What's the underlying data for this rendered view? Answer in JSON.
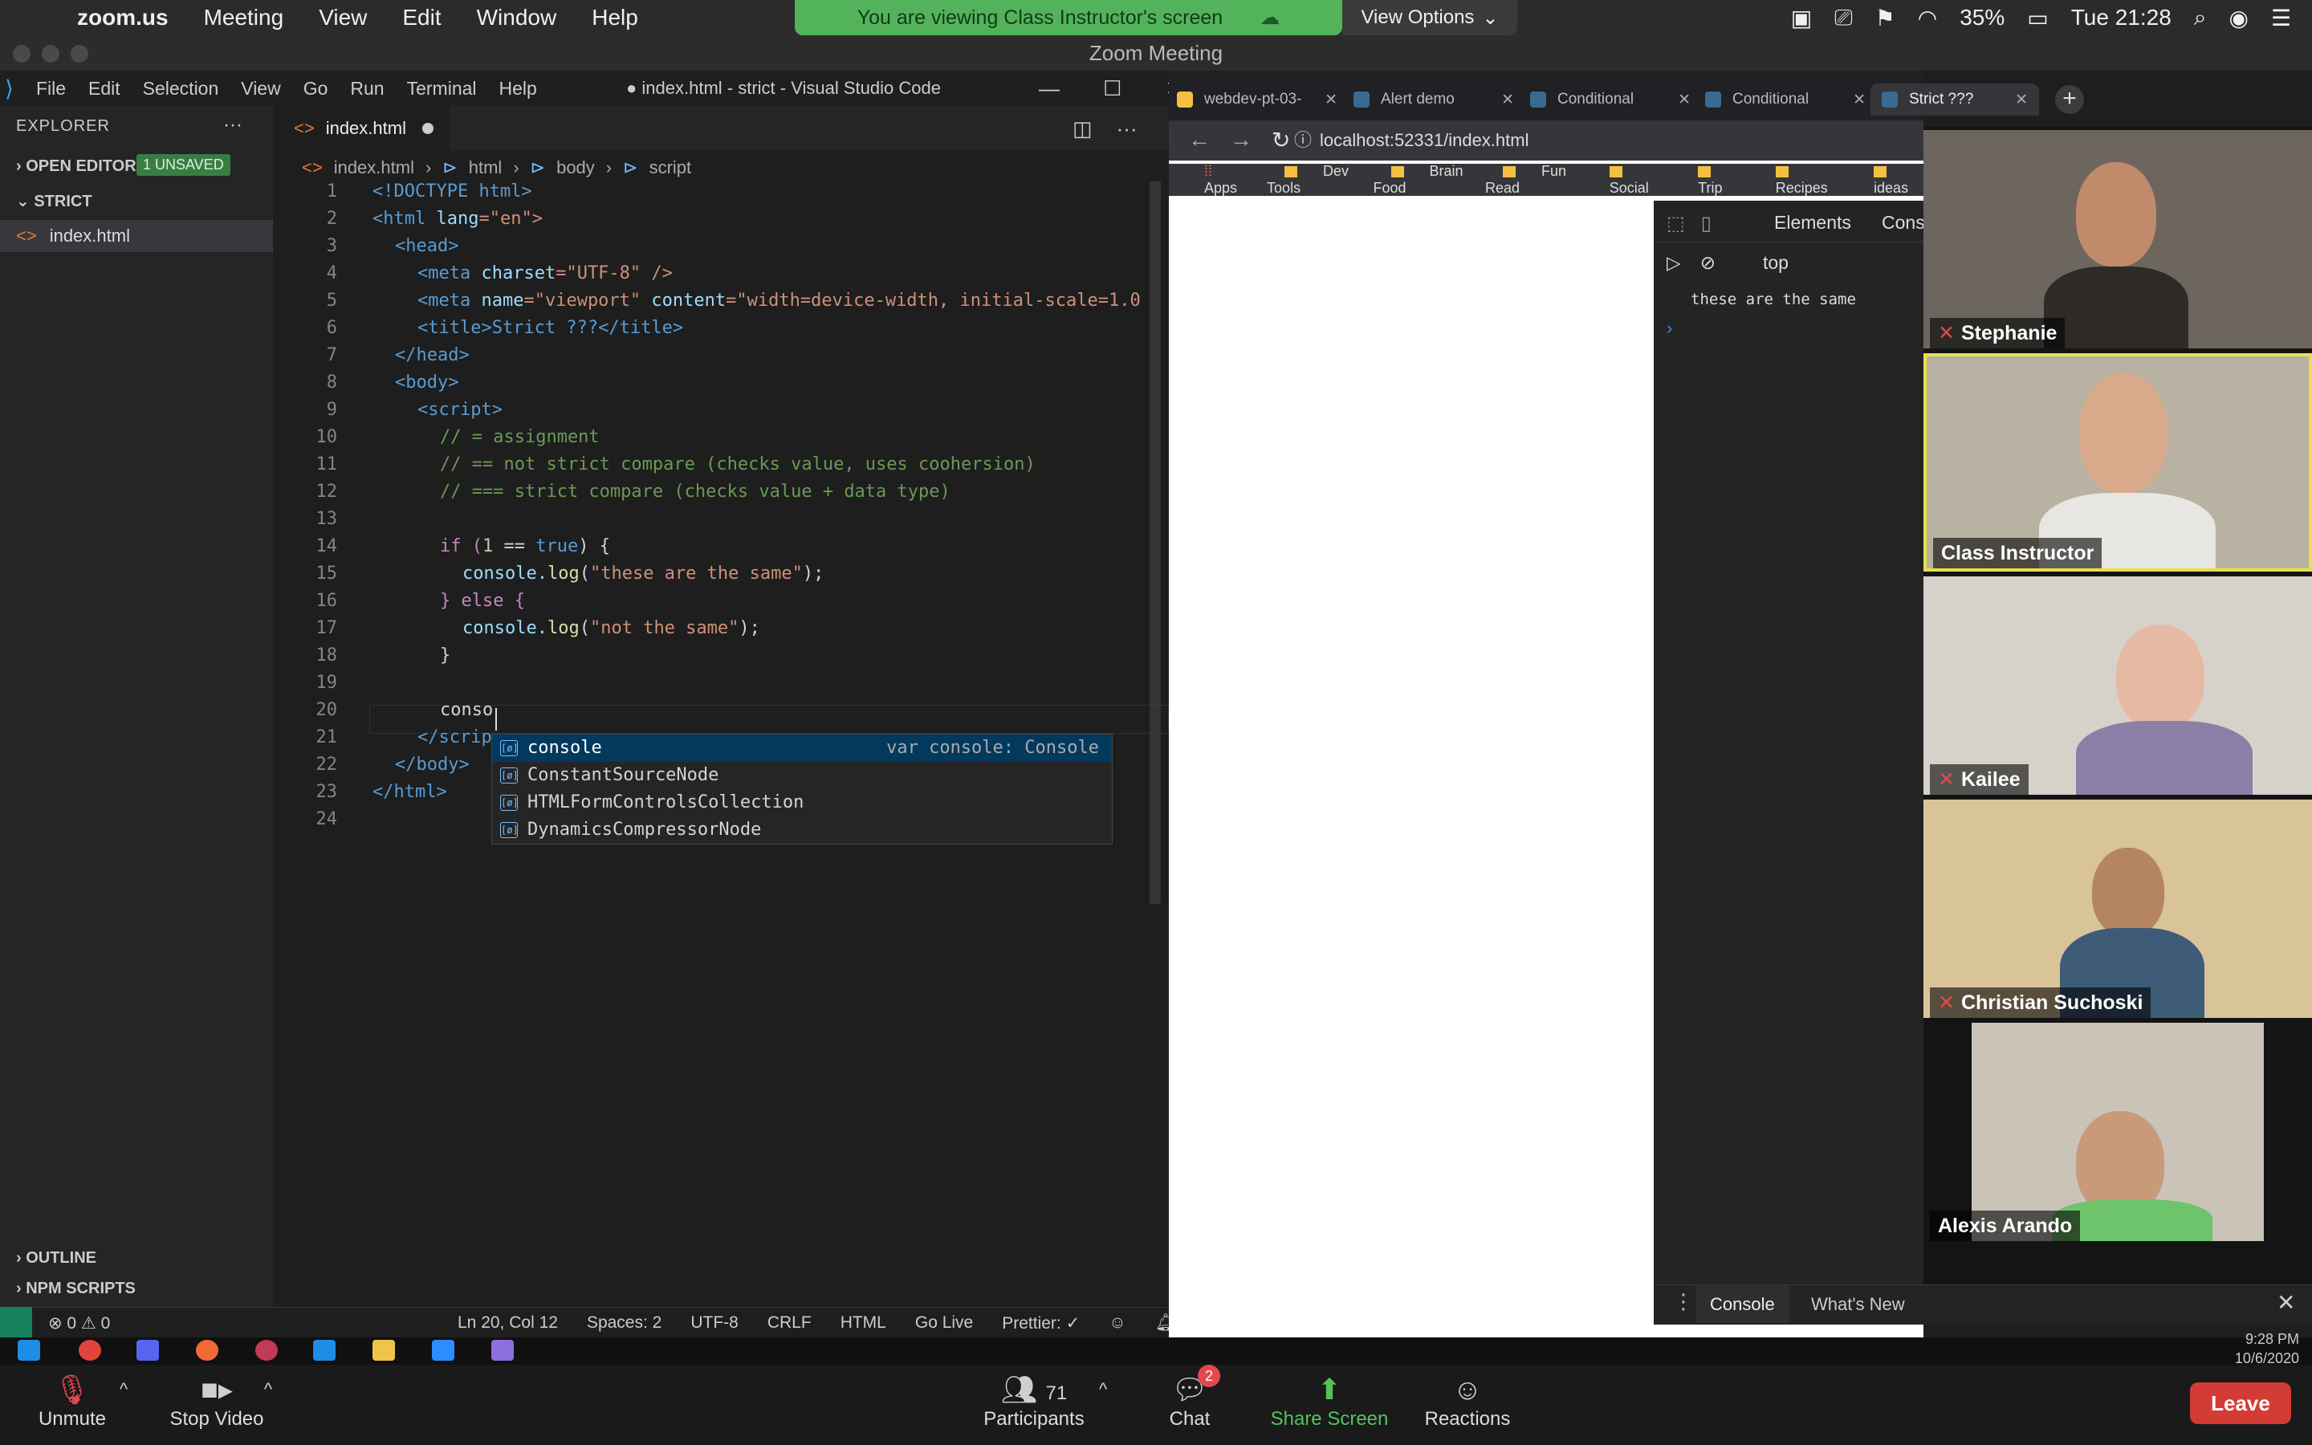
{
  "menubar": {
    "app": "zoom.us",
    "items": [
      "Meeting",
      "View",
      "Edit",
      "Window",
      "Help"
    ],
    "share_banner": "You are viewing Class Instructor's screen",
    "view_options": "View Options",
    "battery": "35%",
    "clock": "Tue 21:28"
  },
  "zoom_window_title": "Zoom Meeting",
  "vscode": {
    "menu": [
      "File",
      "Edit",
      "Selection",
      "View",
      "Go",
      "Run",
      "Terminal",
      "Help"
    ],
    "title": "● index.html - strict - Visual Studio Code",
    "sidebar": {
      "explorer": "EXPLORER",
      "open_editors": "OPEN EDITORS",
      "unsaved_badge": "1 UNSAVED",
      "folder": "STRICT",
      "file": "index.html",
      "outline": "OUTLINE",
      "npm_scripts": "NPM SCRIPTS"
    },
    "tab": "index.html",
    "breadcrumb": [
      "index.html",
      "html",
      "body",
      "script"
    ],
    "line_numbers": [
      "1",
      "2",
      "3",
      "4",
      "5",
      "6",
      "7",
      "8",
      "9",
      "10",
      "11",
      "12",
      "13",
      "14",
      "15",
      "16",
      "17",
      "18",
      "19",
      "20",
      "21",
      "22",
      "23",
      "24"
    ],
    "code": {
      "l1": "<!DOCTYPE html>",
      "l2a": "<html ",
      "l2b": "lang",
      "l2c": "=\"en\">",
      "l3": "<head>",
      "l4a": "<meta ",
      "l4b": "charset",
      "l4c": "=\"UTF-8\" />",
      "l5a": "<meta ",
      "l5b": "name",
      "l5c": "=\"viewport\" ",
      "l5d": "content",
      "l5e": "=\"width=device-width, initial-scale=1.0",
      "l6": "<title>Strict ???</title>",
      "l7": "</head>",
      "l8": "<body>",
      "l9": "<script>",
      "l10": "// = assignment",
      "l11": "// == not strict compare (checks value, uses coohersion)",
      "l12": "// === strict compare (checks value + data type)",
      "l14a": "if (",
      "l14b": "1",
      "l14c": " == ",
      "l14d": "true",
      "l14e": ") {",
      "l15a": "console.",
      "l15b": "log",
      "l15c": "(",
      "l15d": "\"these are the same\"",
      "l15e": ");",
      "l16": "} else {",
      "l17a": "console.",
      "l17b": "log",
      "l17c": "(",
      "l17d": "\"not the same\"",
      "l17e": ");",
      "l18": "}",
      "l20": "conso",
      "l21": "</scrip",
      "l22": "</body>",
      "l23": "</html>"
    },
    "suggestions": [
      {
        "label": "console",
        "detail": "var console: Console"
      },
      {
        "label": "ConstantSourceNode"
      },
      {
        "label": "HTMLFormControlsCollection"
      },
      {
        "label": "DynamicsCompressorNode"
      }
    ],
    "status": {
      "errors": "⊗ 0 ⚠ 0",
      "position": "Ln 20, Col 12",
      "spaces": "Spaces: 2",
      "encoding": "UTF-8",
      "eol": "CRLF",
      "language": "HTML",
      "golive": "Go Live",
      "prettier": "Prettier: ✓"
    }
  },
  "chrome": {
    "tabs": [
      "webdev-pt-03-",
      "Alert demo",
      "Conditional",
      "Conditional",
      "Strict ???"
    ],
    "url": "localhost:52331/index.html",
    "bookmarks": [
      "Apps",
      "Dev Tools",
      "Brain Food",
      "Fun Read",
      "Social",
      "Trip",
      "Recipes",
      "ideas"
    ],
    "devtools": {
      "tab_elements": "Elements",
      "tab_console": "Cons",
      "context": "top",
      "log": "these are the same",
      "drawer_console": "Console",
      "drawer_whatsnew": "What's New"
    }
  },
  "participants_video": [
    {
      "name": "Stephanie",
      "muted": true
    },
    {
      "name": "Class Instructor",
      "muted": false
    },
    {
      "name": "Kailee",
      "muted": true
    },
    {
      "name": "Christian Suchoski",
      "muted": true
    },
    {
      "name": "Alexis Arando",
      "muted": false
    }
  ],
  "zoom_controls": {
    "unmute": "Unmute",
    "stop_video": "Stop Video",
    "participants": "Participants",
    "participant_count": "71",
    "chat": "Chat",
    "chat_badge": "2",
    "share": "Share Screen",
    "reactions": "Reactions",
    "leave": "Leave"
  },
  "taskbar_clock": {
    "time": "9:28 PM",
    "date": "10/6/2020"
  },
  "colors": {
    "share_green": "#53b35b",
    "leave_red": "#d33c34",
    "active_speaker": "#e8df4b"
  }
}
